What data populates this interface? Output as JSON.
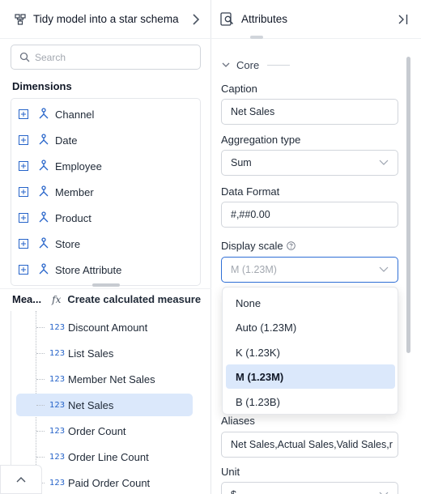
{
  "left_panel": {
    "header_title": "Tidy model into a star schema",
    "search_placeholder": "Search",
    "dimensions_label": "Dimensions",
    "dimensions": [
      "Channel",
      "Date",
      "Employee",
      "Member",
      "Product",
      "Store",
      "Store Attribute"
    ],
    "measures_label": "Mea...",
    "fx_label": "fx",
    "create_calculated_measure": "Create calculated measure",
    "measure_type_badge": "123",
    "measures": [
      "Discount Amount",
      "List Sales",
      "Member Net Sales",
      "Net Sales",
      "Order Count",
      "Order Line Count",
      "Paid Order Count"
    ],
    "selected_measure": "Net Sales"
  },
  "right_panel": {
    "title": "Attributes",
    "section": "Core",
    "caption_label": "Caption",
    "caption_value": "Net Sales",
    "aggregation_label": "Aggregation type",
    "aggregation_value": "Sum",
    "format_label": "Data Format",
    "format_value": "#,##0.00",
    "display_scale_label": "Display scale",
    "display_scale_value": "M (1.23M)",
    "display_scale_options": [
      "None",
      "Auto (1.23M)",
      "K (1.23K)",
      "M (1.23M)",
      "B (1.23B)"
    ],
    "aliases_label": "Aliases",
    "aliases_value": "Net Sales,Actual Sales,Valid Sales,r",
    "unit_label": "Unit",
    "unit_value": "$"
  },
  "colors": {
    "accent": "#2563c9",
    "selection": "#dbe8fb",
    "border": "#d1d5db",
    "focus_border": "#2f6fd6"
  },
  "icons": [
    "model-icon",
    "chevron-right-icon",
    "search-icon",
    "expand-plus-icon",
    "dimension-hierarchy-icon",
    "chevron-up-icon",
    "attributes-icon",
    "collapse-panel-icon",
    "chevron-down-icon",
    "help-circle-icon"
  ]
}
